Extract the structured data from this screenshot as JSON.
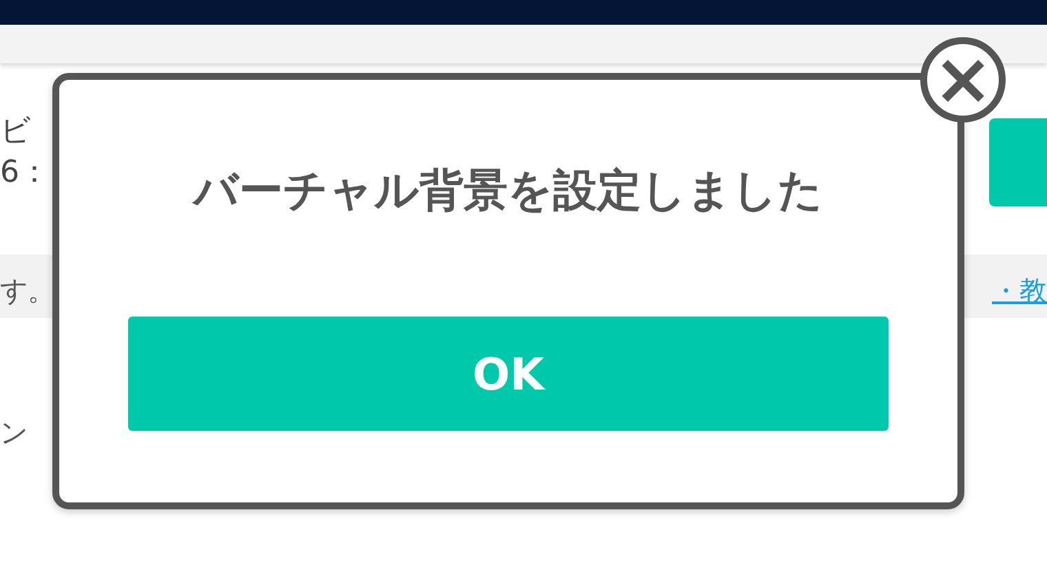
{
  "background": {
    "lines": [
      "ビ",
      "6："
    ],
    "notice": "す。",
    "notice_link": "・教",
    "footer_text": "ン"
  },
  "dialog": {
    "title": "バーチャル背景を設定しました",
    "button": "OK",
    "close": "×"
  }
}
